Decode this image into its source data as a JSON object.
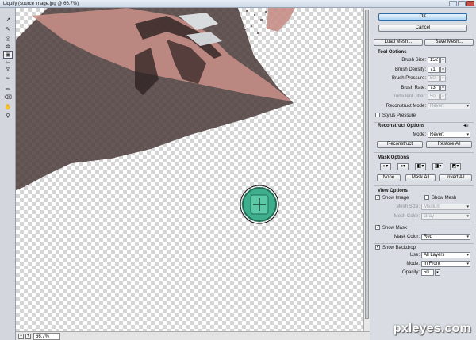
{
  "window": {
    "title": "Liquify (source image.jpg @ 66.7%)"
  },
  "toolbar": {
    "tools": [
      "forward-warp",
      "reconstruct",
      "twirl",
      "pucker",
      "bloat",
      "push-left",
      "mirror",
      "turbulence",
      "freeze-mask",
      "thaw-mask",
      "hand",
      "zoom"
    ]
  },
  "status": {
    "zoom": "66.7%",
    "zoom_out": "−",
    "zoom_in": "+"
  },
  "buttons": {
    "ok": "OK",
    "cancel": "Cancel",
    "load_mesh": "Load Mesh...",
    "save_mesh": "Save Mesh..."
  },
  "tool_options": {
    "header": "Tool Options",
    "brush_size_label": "Brush Size:",
    "brush_size": "152",
    "brush_density_label": "Brush Density:",
    "brush_density": "71",
    "brush_pressure_label": "Brush Pressure:",
    "brush_pressure": "50",
    "brush_rate_label": "Brush Rate:",
    "brush_rate": "73",
    "turbulent_jitter_label": "Turbulent Jitter:",
    "turbulent_jitter": "50",
    "reconstruct_mode_label": "Reconstruct Mode:",
    "reconstruct_mode": "Revert",
    "stylus_pressure_label": "Stylus Pressure"
  },
  "reconstruct_options": {
    "header": "Reconstruct Options",
    "mode_label": "Mode:",
    "mode": "Revert",
    "reconstruct_btn": "Reconstruct",
    "restore_all_btn": "Restore All"
  },
  "mask_options": {
    "header": "Mask Options",
    "none_btn": "None",
    "mask_all_btn": "Mask All",
    "invert_all_btn": "Invert All"
  },
  "view_options": {
    "header": "View Options",
    "show_image": "Show Image",
    "show_mesh": "Show Mesh",
    "mesh_size_label": "Mesh Size:",
    "mesh_size": "Medium",
    "mesh_color_label": "Mesh Color:",
    "mesh_color": "Gray",
    "show_mask": "Show Mask",
    "mask_color_label": "Mask Color:",
    "mask_color": "Red",
    "show_backdrop": "Show Backdrop",
    "use_label": "Use:",
    "use": "All Layers",
    "mode_label": "Mode:",
    "mode": "In Front",
    "opacity_label": "Opacity:",
    "opacity": "50"
  },
  "watermark": "pxleyes.com",
  "colors": {
    "mask_red": "#c58d86",
    "ink_dark": "#3d2b28",
    "brush_teal": "#3fae8c"
  }
}
